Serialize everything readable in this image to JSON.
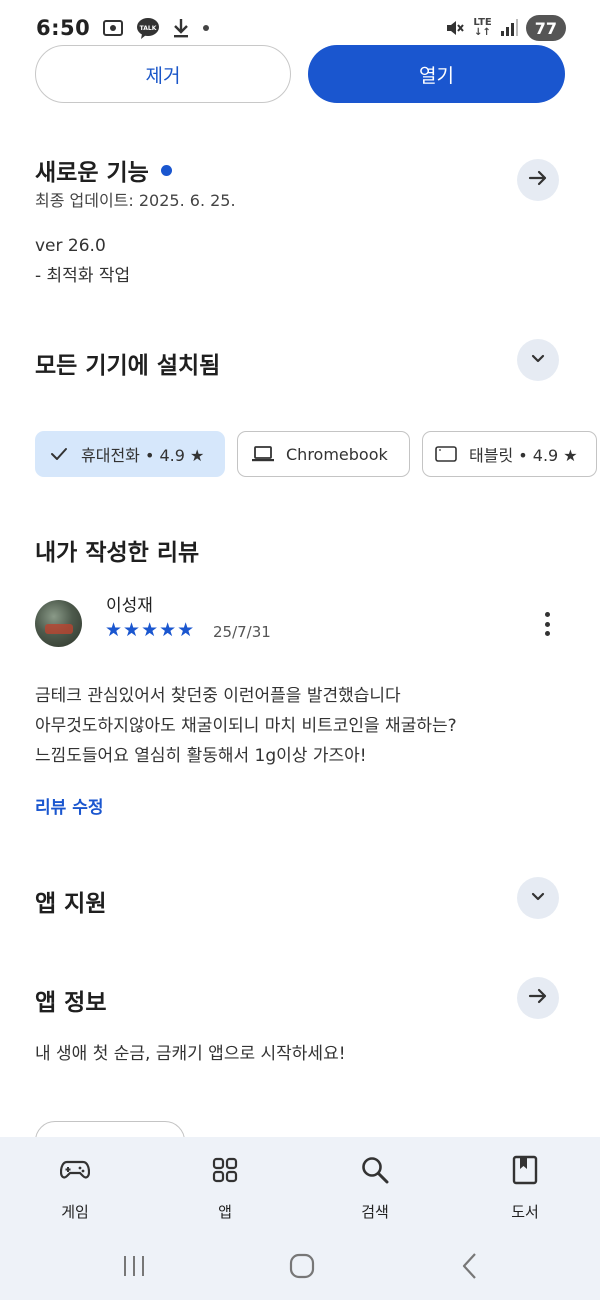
{
  "status_bar": {
    "time": "6:50",
    "talk_badge": "TALK",
    "network": "LTE",
    "battery": "77"
  },
  "actions": {
    "remove_label": "제거",
    "open_label": "열기"
  },
  "whats_new": {
    "title": "새로운 기능",
    "last_updated": "최종 업데이트: 2025. 6. 25.",
    "version": "ver 26.0",
    "notes": "- 최적화 작업"
  },
  "installed": {
    "title": "모든 기기에 설치됨",
    "chips": [
      {
        "label": "휴대전화 • 4.9 ★",
        "selected": true
      },
      {
        "label": "Chromebook",
        "selected": false
      },
      {
        "label": "태블릿 • 4.9 ★",
        "selected": false
      }
    ]
  },
  "my_review": {
    "title": "내가 작성한 리뷰",
    "reviewer": "이성재",
    "stars": "★★★★★",
    "rating": 5,
    "date": "25/7/31",
    "lines": [
      "금테크 관심있어서 찾던중 이런어플을 발견했습니다",
      "아무것도하지않아도 채굴이되니 마치 비트코인을 채굴하는?",
      "느낌도들어요 열심히 활동해서 1g이상 가즈아!"
    ],
    "edit_label": "리뷰 수정"
  },
  "app_support": {
    "title": "앱 지원"
  },
  "app_info": {
    "title": "앱 정보",
    "description": "내 생애 첫 순금, 금캐기 앱으로 시작하세요!"
  },
  "bottom_nav": {
    "items": [
      {
        "label": "게임",
        "icon": "gamepad-icon"
      },
      {
        "label": "앱",
        "icon": "apps-grid-icon"
      },
      {
        "label": "검색",
        "icon": "search-icon"
      },
      {
        "label": "도서",
        "icon": "book-icon"
      }
    ]
  },
  "colors": {
    "accent": "#1a56cf",
    "chip_selected": "#d6e7fb",
    "circle_button": "#e6ebf3",
    "nav_background": "#eef2f8"
  }
}
